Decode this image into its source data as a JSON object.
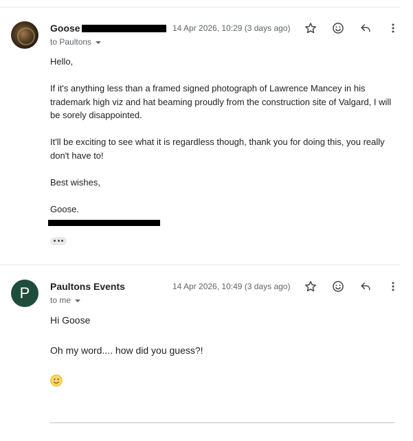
{
  "message1": {
    "sender": "Goose",
    "date": "14 Apr 2026, 10:29 (3 days ago)",
    "to_line": "to Paultons",
    "body": [
      "Hello,",
      "If it's anything less than a framed signed photograph of Lawrence Mancey in his trademark high viz and hat beaming proudly from the construction site of Valgard, I will be sorely disappointed.",
      "It'll be exciting to see what it is regardless though, thank you for doing this, you really don't have to!",
      "Best wishes,",
      "Goose."
    ],
    "show_trimmed": "•••"
  },
  "message2": {
    "sender": "Paultons Events",
    "avatar_letter": "P",
    "avatar_color": "#1e4d3c",
    "date": "14 Apr 2026, 10:49 (3 days ago)",
    "to_line": "to me",
    "body": [
      "Hi Goose",
      "Oh my word.... how did you guess?!"
    ]
  },
  "icons": [
    "star-icon",
    "emoji-icon",
    "reply-icon",
    "more-vert-icon",
    "slightly-smiling-face-emoji"
  ]
}
